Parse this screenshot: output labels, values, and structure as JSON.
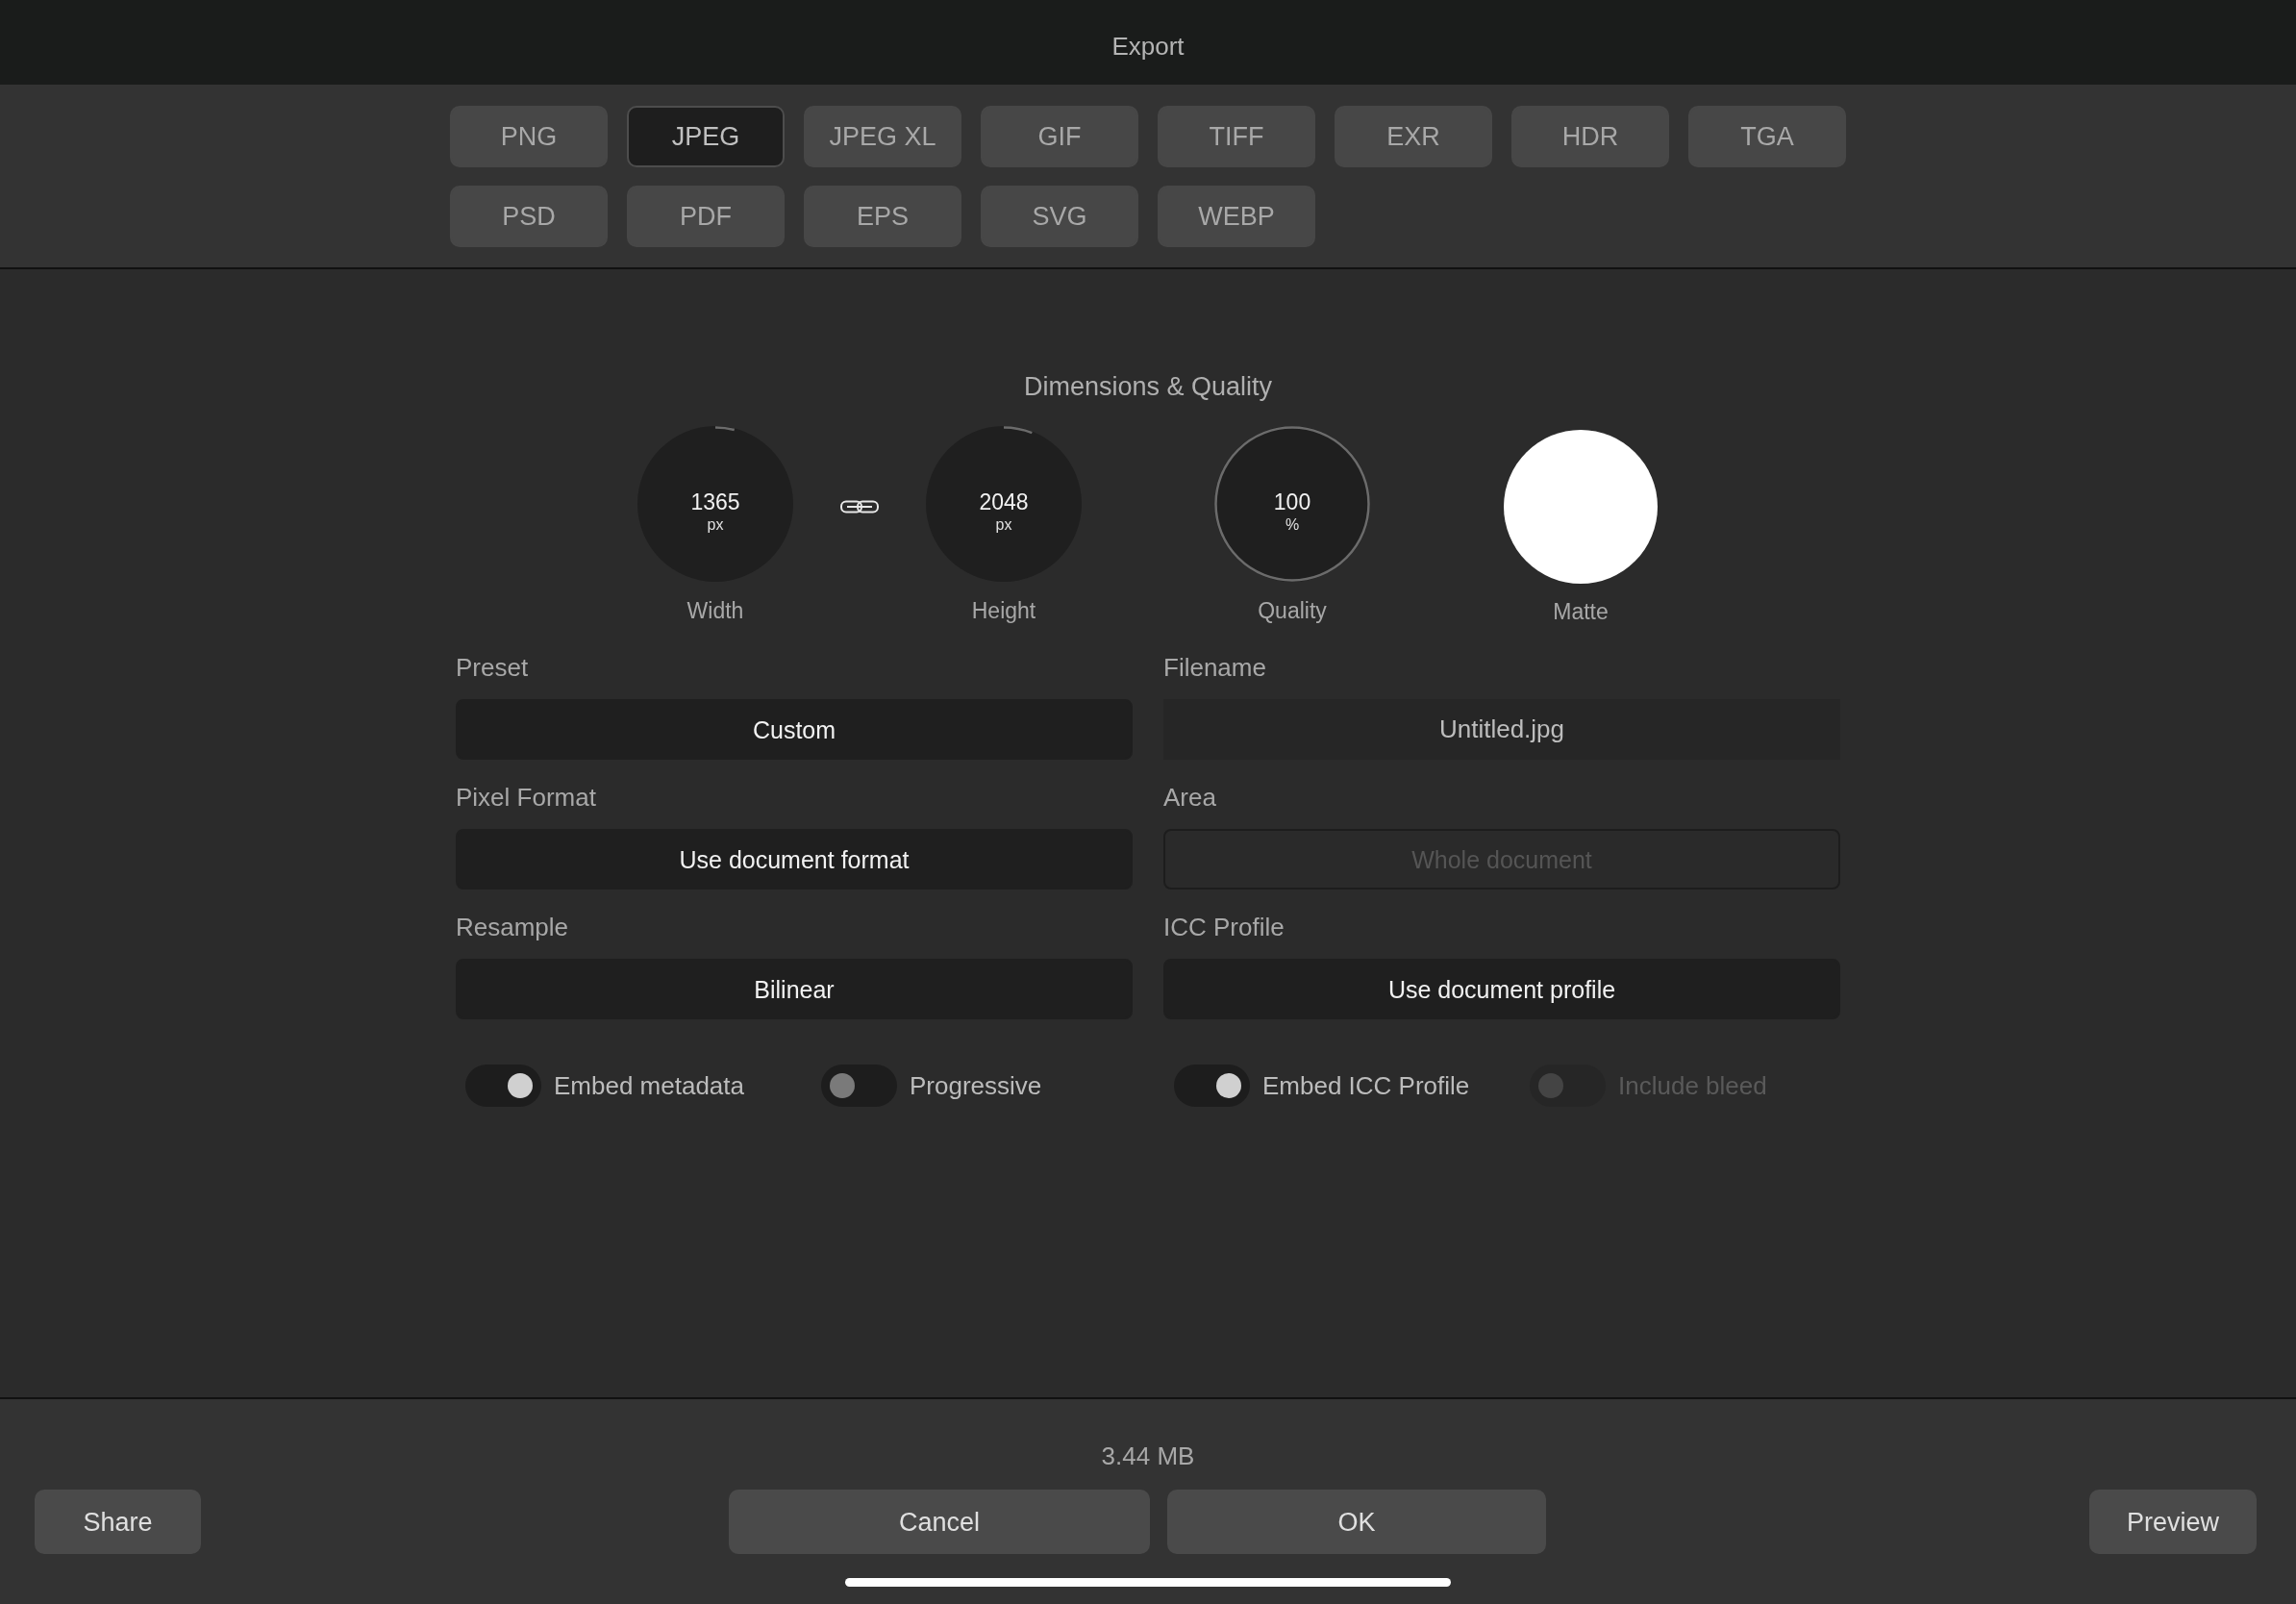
{
  "window": {
    "title": "Export"
  },
  "formats": [
    {
      "label": "PNG",
      "selected": false
    },
    {
      "label": "JPEG",
      "selected": true
    },
    {
      "label": "JPEG XL",
      "selected": false
    },
    {
      "label": "GIF",
      "selected": false
    },
    {
      "label": "TIFF",
      "selected": false
    },
    {
      "label": "EXR",
      "selected": false
    },
    {
      "label": "HDR",
      "selected": false
    },
    {
      "label": "TGA",
      "selected": false
    },
    {
      "label": "PSD",
      "selected": false
    },
    {
      "label": "PDF",
      "selected": false
    },
    {
      "label": "EPS",
      "selected": false
    },
    {
      "label": "SVG",
      "selected": false
    },
    {
      "label": "WEBP",
      "selected": false
    }
  ],
  "dimensions": {
    "title": "Dimensions & Quality",
    "dials": [
      {
        "kind": "dial",
        "value": "1365",
        "unit": "px",
        "label": "Width",
        "level": 0.04
      },
      {
        "kind": "link"
      },
      {
        "kind": "dial",
        "value": "2048",
        "unit": "px",
        "label": "Height",
        "level": 0.06
      },
      {
        "kind": "dial",
        "value": "100",
        "unit": "%",
        "label": "Quality",
        "level": 1
      },
      {
        "kind": "swatch",
        "label": "Matte",
        "color": "#ffffff"
      }
    ]
  },
  "fields": [
    {
      "label": "Preset",
      "kind": "select",
      "value": "Custom",
      "disabled": false
    },
    {
      "label": "Filename",
      "kind": "input",
      "value": "Untitled.jpg",
      "disabled": false
    },
    {
      "label": "Pixel Format",
      "kind": "select",
      "value": "Use document format",
      "disabled": false
    },
    {
      "label": "Area",
      "kind": "select",
      "value": "Whole document",
      "disabled": true
    },
    {
      "label": "Resample",
      "kind": "select",
      "value": "Bilinear",
      "disabled": false
    },
    {
      "label": "ICC Profile",
      "kind": "select",
      "value": "Use document profile",
      "disabled": false
    }
  ],
  "toggles": [
    {
      "label": "Embed metadata",
      "on": true,
      "disabled": false
    },
    {
      "label": "Progressive",
      "on": false,
      "disabled": false
    },
    {
      "label": "Embed ICC Profile",
      "on": true,
      "disabled": false
    },
    {
      "label": "Include bleed",
      "on": false,
      "disabled": true
    }
  ],
  "footer": {
    "file_size": "3.44 MB",
    "left_buttons": [
      "Share"
    ],
    "center_buttons": [
      "Cancel",
      "OK"
    ],
    "right_buttons": [
      "Preview"
    ]
  }
}
